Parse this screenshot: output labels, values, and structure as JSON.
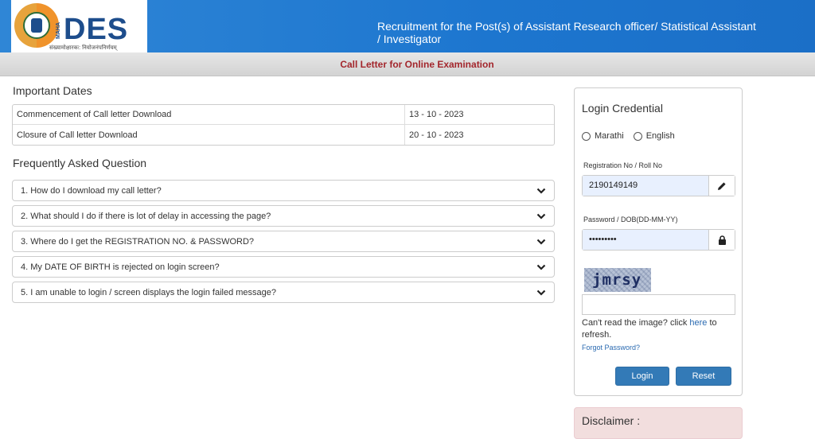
{
  "header": {
    "logo_text": "DES",
    "logo_side_text": "MAHA",
    "logo_tagline": "संख्यामोक्षारकः: नियोजनंपनिर्णयम्",
    "title": "Recruitment for the Post(s) of Assistant Research officer/ Statistical Assistant / Investigator",
    "colors": {
      "header_blue": "#1d76cf",
      "accent_red": "#a3262c",
      "link_blue": "#2a6ab1",
      "button_blue": "#337ab7"
    }
  },
  "subbar": {
    "title": "Call Letter for Online Examination"
  },
  "important_dates": {
    "heading": "Important Dates",
    "rows": [
      {
        "label": "Commencement of Call letter Download",
        "date": "13 - 10 - 2023"
      },
      {
        "label": "Closure of Call letter Download",
        "date": "20 - 10 - 2023"
      }
    ]
  },
  "faq": {
    "heading": "Frequently Asked Question",
    "items": [
      {
        "text": "1. How do I download my call letter?",
        "icon": "chevron-down-icon"
      },
      {
        "text": "2. What should I do if there is lot of delay in accessing the page?",
        "icon": "chevron-down-icon"
      },
      {
        "text": "3. Where do I get the REGISTRATION NO. & PASSWORD?",
        "icon": "chevron-down-icon"
      },
      {
        "text": "4. My DATE OF BIRTH is rejected on login screen?",
        "icon": "chevron-down-icon"
      },
      {
        "text": "5. I am unable to login / screen displays the login failed message?",
        "icon": "chevron-down-icon"
      }
    ]
  },
  "login": {
    "title": "Login Credential",
    "languages": [
      "Marathi",
      "English"
    ],
    "registration_label": "Registration No / Roll No",
    "registration_value": "2190149149",
    "registration_icon": "pencil-icon",
    "password_label": "Password / DOB(DD-MM-YY)",
    "password_value": "•••••••••",
    "password_icon": "lock-icon",
    "captcha_text": "jmrsy",
    "captcha_input_value": "",
    "refresh_prefix": "Can't read the image? click",
    "refresh_link": "here",
    "refresh_suffix": "to refresh.",
    "forgot_password": "Forgot Password?",
    "login_button": "Login",
    "reset_button": "Reset"
  },
  "disclaimer": {
    "title": "Disclaimer :"
  }
}
